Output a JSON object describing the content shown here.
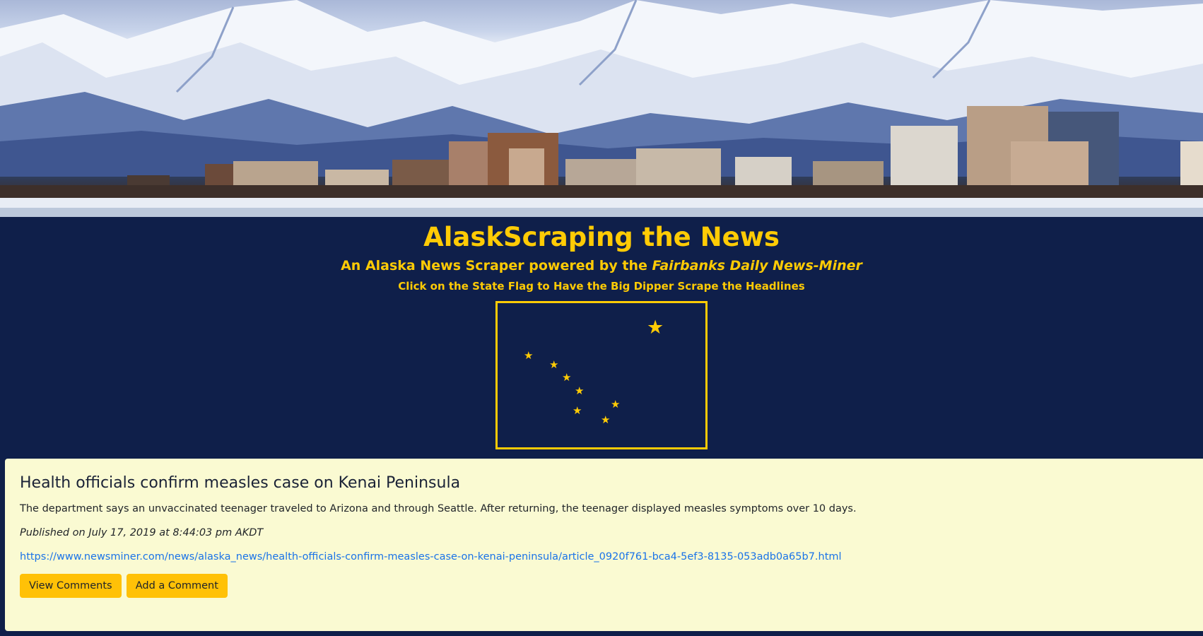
{
  "header": {
    "title": "AlaskScraping the News",
    "subtitle_prefix": "An Alaska News Scraper powered by the ",
    "subtitle_source": "Fairbanks Daily News-Miner",
    "instruction": "Click on the State Flag to Have the Big Dipper Scrape the Headlines"
  },
  "colors": {
    "background": "#0f1f4a",
    "accent": "#ffcb05",
    "card_background": "#fafad2",
    "button": "#ffc107",
    "link": "#1a73e8"
  },
  "flag": {
    "star_icon": "star-icon",
    "star_count": 8
  },
  "article": {
    "title": "Health officials confirm measles case on Kenai Peninsula",
    "summary": "The department says an unvaccinated teenager traveled to Arizona and through Seattle. After returning, the teenager displayed measles symptoms over 10 days.",
    "published": "Published on July 17, 2019 at 8:44:03 pm AKDT",
    "url": "https://www.newsminer.com/news/alaska_news/health-officials-confirm-measles-case-on-kenai-peninsula/article_0920f761-bca4-5ef3-8135-053adb0a65b7.html",
    "view_comments_label": "View Comments",
    "add_comment_label": "Add a Comment"
  }
}
